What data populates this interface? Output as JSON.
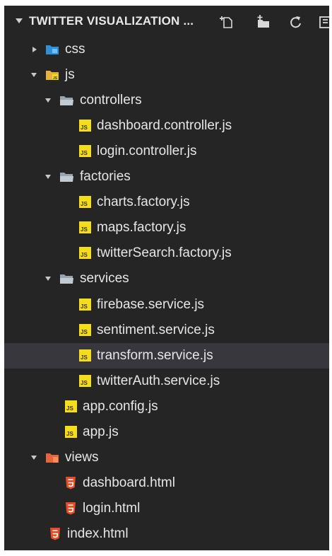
{
  "explorer": {
    "title": "TWITTER VISUALIZATION ...",
    "actions": [
      "new-file-icon",
      "new-folder-icon",
      "refresh-icon",
      "collapse-all-icon"
    ]
  },
  "tree": [
    {
      "label": "css",
      "kind": "folder-css",
      "depth": 0,
      "expanded": false
    },
    {
      "label": "js",
      "kind": "folder-js",
      "depth": 0,
      "expanded": true
    },
    {
      "label": "controllers",
      "kind": "folder",
      "depth": 1,
      "expanded": true
    },
    {
      "label": "dashboard.controller.js",
      "kind": "js",
      "depth": 2
    },
    {
      "label": "login.controller.js",
      "kind": "js",
      "depth": 2
    },
    {
      "label": "factories",
      "kind": "folder",
      "depth": 1,
      "expanded": true
    },
    {
      "label": "charts.factory.js",
      "kind": "js",
      "depth": 2
    },
    {
      "label": "maps.factory.js",
      "kind": "js",
      "depth": 2
    },
    {
      "label": "twitterSearch.factory.js",
      "kind": "js",
      "depth": 2
    },
    {
      "label": "services",
      "kind": "folder",
      "depth": 1,
      "expanded": true
    },
    {
      "label": "firebase.service.js",
      "kind": "js",
      "depth": 2
    },
    {
      "label": "sentiment.service.js",
      "kind": "js",
      "depth": 2
    },
    {
      "label": "transform.service.js",
      "kind": "js",
      "depth": 2,
      "selected": true
    },
    {
      "label": "twitterAuth.service.js",
      "kind": "js",
      "depth": 2
    },
    {
      "label": "app.config.js",
      "kind": "js",
      "depth": 1
    },
    {
      "label": "app.js",
      "kind": "js",
      "depth": 1
    },
    {
      "label": "views",
      "kind": "folder-views",
      "depth": 0,
      "expanded": true
    },
    {
      "label": "dashboard.html",
      "kind": "html",
      "depth": 1
    },
    {
      "label": "login.html",
      "kind": "html",
      "depth": 1
    },
    {
      "label": "index.html",
      "kind": "html",
      "depth": 0
    }
  ],
  "colors": {
    "background": "#252526",
    "selected_row": "#37373d",
    "text": "#e6e6e6",
    "js_badge": "#f5de19",
    "html_icon": "#e44d26",
    "folder_generic": "#9aa4ad",
    "folder_css": "#2f8fd8",
    "folder_js": "#e8b23a",
    "folder_views": "#e8643a"
  }
}
